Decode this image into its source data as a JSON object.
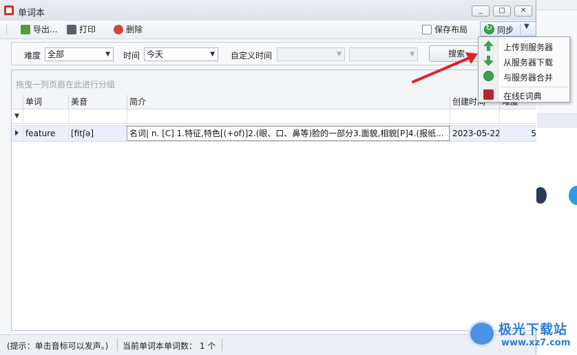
{
  "window": {
    "title": "单词本",
    "controls": [
      "_",
      "□",
      "✕"
    ]
  },
  "toolbar": {
    "export_label": "导出...",
    "print_label": "打印",
    "delete_label": "删除",
    "save_layout_label": "保存布局",
    "sync_label": "同步"
  },
  "filters": {
    "difficulty_label": "难度",
    "difficulty_value": "全部",
    "time_label": "时间",
    "time_value": "今天",
    "custom_time_label": "自定义时间",
    "custom_start_value": "",
    "custom_end_value": "",
    "search_label": "搜索"
  },
  "grid": {
    "group_hint": "拖曳一列页眉在此进行分组",
    "columns": [
      "单词",
      "美音",
      "简介",
      "创建时间",
      "难度"
    ],
    "rows": [
      {
        "word": "feature",
        "us_phonetic": "[fitʃə]",
        "summary": "名词| n. [C]  1.特征,特色[(+of)]2.(眼、口、鼻等)脸的一部分3.面貌,相貌[P]4.(报纸...",
        "created": "2023-05-22",
        "difficulty": "5"
      }
    ]
  },
  "status": {
    "hint": "(提示：单击音标可以发声。)",
    "word_count": "当前单词本单词数： 1 个"
  },
  "sync_menu": {
    "items": [
      {
        "label": "上传到服务器",
        "icon": "upload-arrow-icon"
      },
      {
        "label": "从服务器下载",
        "icon": "download-arrow-icon"
      },
      {
        "label": "与服务器合并",
        "icon": "merge-sync-icon"
      },
      {
        "label": "在线E词典",
        "icon": "dictionary-icon"
      }
    ]
  },
  "watermark": {
    "title": "极光下载站",
    "url": "www.xz7.com"
  },
  "colors": {
    "accent_blue": "#2b7ed6",
    "selected_row": "#e9f0fb",
    "menu_green": "#3aa345",
    "annotation_red": "#d9232a"
  }
}
